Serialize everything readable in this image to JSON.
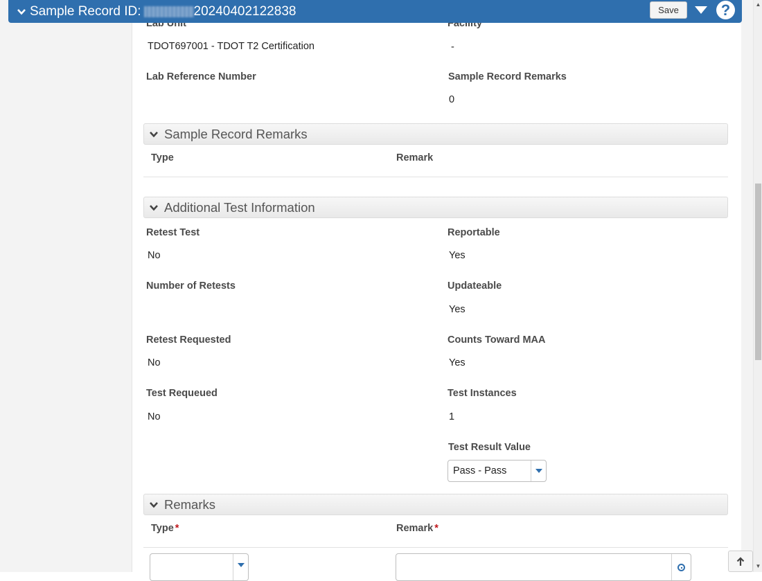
{
  "header": {
    "title_label": "Sample Record ID:",
    "title_id": "20240402122838",
    "save_label": "Save",
    "help_symbol": "?"
  },
  "top_fields": {
    "lab_unit_label": "Lab Unit",
    "lab_unit_value": "TDOT697001 - TDOT T2 Certification",
    "facility_label": "Facility",
    "facility_value": "-",
    "lab_ref_label": "Lab Reference Number",
    "lab_ref_value": "",
    "remarks_count_label": "Sample Record Remarks",
    "remarks_count_value": "0"
  },
  "sample_remarks_section": {
    "title": "Sample Record Remarks",
    "col_type": "Type",
    "col_remark": "Remark"
  },
  "additional_section": {
    "title": "Additional Test Information",
    "retest_test_label": "Retest Test",
    "retest_test_value": "No",
    "reportable_label": "Reportable",
    "reportable_value": "Yes",
    "num_retests_label": "Number of Retests",
    "num_retests_value": "",
    "updateable_label": "Updateable",
    "updateable_value": "Yes",
    "retest_requested_label": "Retest Requested",
    "retest_requested_value": "No",
    "counts_maa_label": "Counts Toward MAA",
    "counts_maa_value": "Yes",
    "test_requeued_label": "Test Requeued",
    "test_requeued_value": "No",
    "test_instances_label": "Test Instances",
    "test_instances_value": "1",
    "test_result_label": "Test Result Value",
    "test_result_value": "Pass - Pass"
  },
  "remarks_section": {
    "title": "Remarks",
    "col_type": "Type",
    "col_remark": "Remark",
    "required_mark": "*",
    "type_value": "",
    "remark_value": ""
  },
  "colors": {
    "header_bg": "#2f6fae",
    "required": "#c0171c",
    "accent": "#2f6fae"
  }
}
